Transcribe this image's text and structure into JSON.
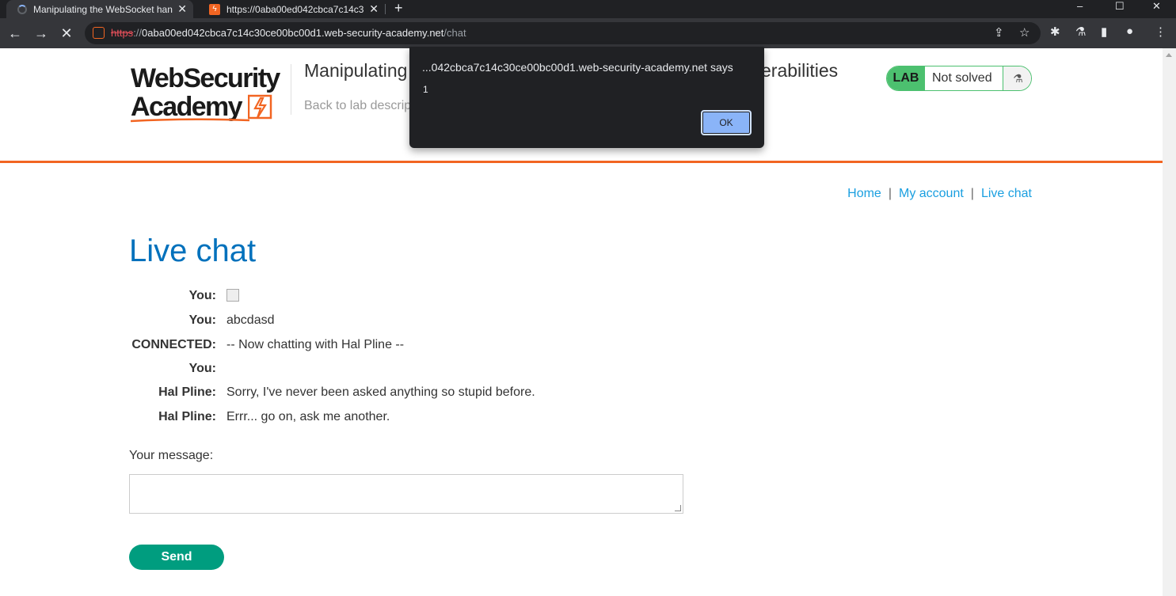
{
  "browser": {
    "tabs": [
      {
        "title": "Manipulating the WebSocket han",
        "loading": true
      },
      {
        "title": "https://0aba00ed042cbca7c14c3",
        "loading": false
      }
    ],
    "tab_close": "✕",
    "new_tab": "+",
    "window_controls": [
      "–",
      "☐",
      "✕"
    ],
    "url_scheme": "https",
    "url_sep": "://",
    "url_host": "0aba00ed042cbca7c14c30ce00bc00d1.web-security-academy.net",
    "url_path": "/chat"
  },
  "header": {
    "logo_line1": "WebSecurity",
    "logo_line2": "Academy",
    "lab_title": "Manipulating",
    "lab_title_tail": "erabilities",
    "back_link": "Back to lab descrip",
    "lab_badge_label": "LAB",
    "lab_status": "Not solved"
  },
  "nav": {
    "home": "Home",
    "account": "My account",
    "live_chat": "Live chat",
    "separator": "|"
  },
  "main": {
    "heading": "Live chat",
    "messages": [
      {
        "who": "You:",
        "text": "",
        "image": true
      },
      {
        "who": "You:",
        "text": "abcdasd"
      },
      {
        "who": "CONNECTED:",
        "text": "-- Now chatting with Hal Pline --"
      },
      {
        "who": "You:",
        "text": ""
      },
      {
        "who": "Hal Pline:",
        "text": "Sorry, I've never been asked anything so stupid before."
      },
      {
        "who": "Hal Pline:",
        "text": "Errr... go on, ask me another."
      }
    ],
    "message_label": "Your message:",
    "send_label": "Send"
  },
  "dialog": {
    "title": "...042cbca7c14c30ce00bc00d1.web-security-academy.net says",
    "message": "1",
    "ok_label": "OK"
  },
  "colors": {
    "accent_orange": "#f26522",
    "link_blue": "#1a9fe0",
    "heading_blue": "#0071bc",
    "lab_green": "#4cc06f",
    "send_green": "#009d7f"
  }
}
